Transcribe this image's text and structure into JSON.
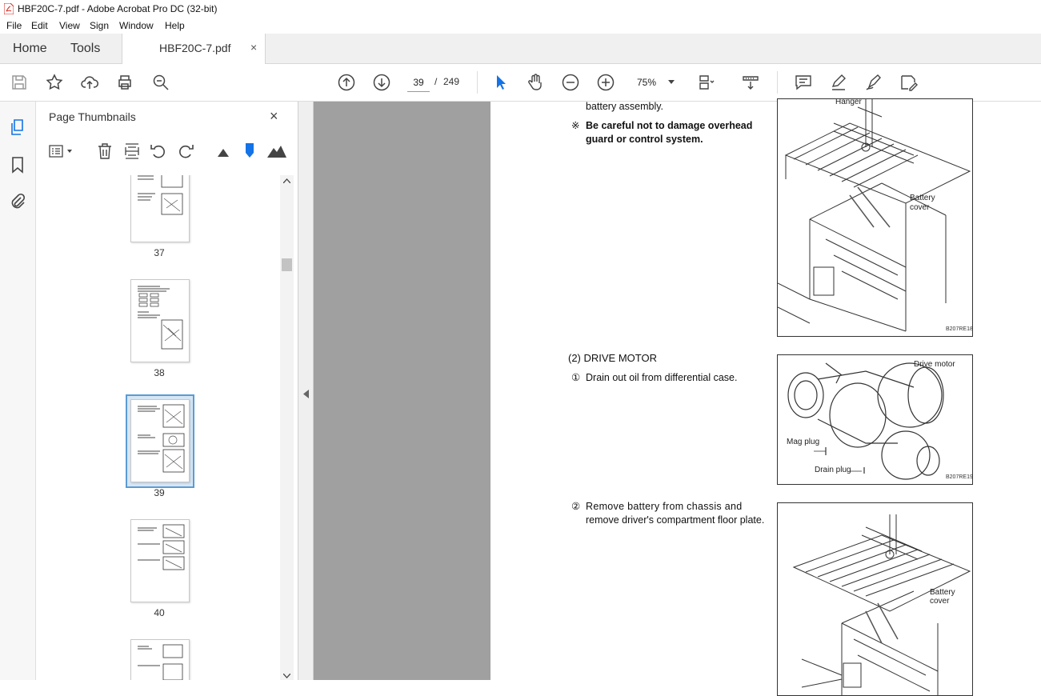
{
  "window": {
    "title": "HBF20C-7.pdf - Adobe Acrobat Pro DC (32-bit)"
  },
  "menu": {
    "items": [
      "File",
      "Edit",
      "View",
      "Sign",
      "Window",
      "Help"
    ]
  },
  "tabs": {
    "home": "Home",
    "tools": "Tools",
    "doc": "HBF20C-7.pdf",
    "close": "×"
  },
  "toolbar": {
    "page_current": "39",
    "page_sep": "/",
    "page_total": "249",
    "zoom": "75%"
  },
  "panel": {
    "title": "Page Thumbnails",
    "close": "×",
    "thumbnails": [
      {
        "label": "37",
        "selected": false
      },
      {
        "label": "38",
        "selected": false
      },
      {
        "label": "39",
        "selected": true
      },
      {
        "label": "40",
        "selected": false
      }
    ]
  },
  "document": {
    "line1": "battery assembly.",
    "note_mark": "※",
    "note_line1": "Be careful not to damage overhead",
    "note_line2": "guard or control system.",
    "section_heading": "(2) DRIVE MOTOR",
    "step1_mark": "①",
    "step1_text": "Drain out oil from differential case.",
    "step2_mark": "②",
    "step2_line1": "Remove battery from chassis and",
    "step2_line2": "remove driver's compartment floor plate.",
    "figure1": {
      "label_hanger": "Hanger",
      "label_battery1": "Battery",
      "label_battery2": "cover",
      "code": "B207RE18"
    },
    "figure2": {
      "label_drive_motor": "Drive motor",
      "label_mag_plug": "Mag plug",
      "label_drain_plug": "Drain plug",
      "code": "B207RE19"
    },
    "figure3": {
      "label_battery1": "Battery",
      "label_battery2": "cover"
    }
  },
  "colors": {
    "accent": "#1473e6",
    "selection": "#5b9bd5"
  }
}
